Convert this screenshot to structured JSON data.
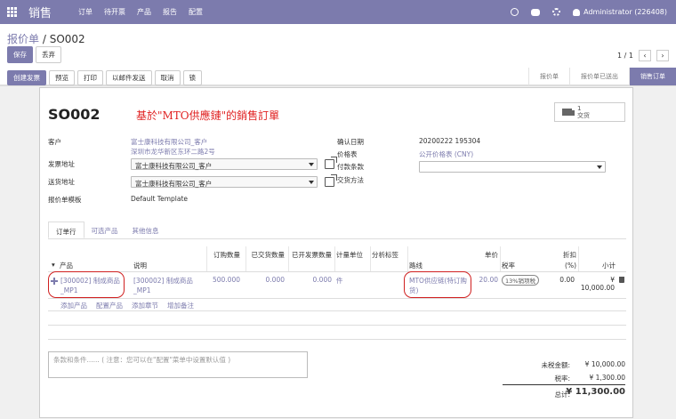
{
  "topbar": {
    "app_title": "销售",
    "menu": [
      "订单",
      "待开票",
      "产品",
      "报告",
      "配置"
    ],
    "user": "Administrator (226408)",
    "icons": [
      "clock-icon",
      "chat-icon",
      "gear-icon",
      "user-icon"
    ]
  },
  "breadcrumb": {
    "parent": "报价单",
    "separator": "/",
    "current": "SO002"
  },
  "buttons": {
    "save": "保存",
    "discard": "丢弃"
  },
  "pager": {
    "value": "1 / 1"
  },
  "actions": [
    "创建发票",
    "预览",
    "打印",
    "以邮件发送",
    "取消",
    "锁"
  ],
  "stages": [
    "报价单",
    "报价单已送出",
    "销售订单"
  ],
  "form": {
    "name": "SO002",
    "annotation": "基於\"MTO供應鏈\"的銷售訂單",
    "smart_button": {
      "count": "1",
      "label": "交货"
    },
    "customer_label": "客户",
    "customer_value": "富士康科技有限公司_客户",
    "customer_address": "深圳市龙华新区东环二路2号",
    "invoice_address_label": "发票地址",
    "invoice_address_value": "富士康科技有限公司_客户",
    "delivery_address_label": "送货地址",
    "delivery_address_value": "富士康科技有限公司_客户",
    "template_label": "报价单模板",
    "template_value": "Default Template",
    "date_label": "确认日期",
    "date_value": "20200222 195304",
    "pricelist_label": "价格表",
    "pricelist_value": "公开价格表 (CNY)",
    "payment_terms_label": "付款条款",
    "payment_terms_value": "",
    "delivery_method_label": "交货方法"
  },
  "tabs": [
    "订单行",
    "可选产品",
    "其他信息"
  ],
  "lines": {
    "headers": {
      "product": "产品",
      "description": "说明",
      "ordered_qty": "订购数量",
      "delivered_qty": "已交货数量",
      "invoiced_qty": "已开发票数量",
      "uom": "计量单位",
      "analytic_tags": "分析标签",
      "route": "路线",
      "unit_price": "单价",
      "taxes": "税率",
      "discount": "折扣\n(%)",
      "subtotal": "小计"
    },
    "rows": [
      {
        "product": "[300002] 制成商品_MP1",
        "description": "[300002] 制成商品_MP1",
        "ordered_qty": "500.000",
        "delivered_qty": "0.000",
        "invoiced_qty": "0.000",
        "uom": "件",
        "route": "MTO供应链(特订购货)",
        "unit_price": "20.00",
        "tax": "13%销项税",
        "discount": "0.00",
        "subtotal": "¥ 10,000.00"
      }
    ],
    "add_links": [
      "添加产品",
      "配置产品",
      "添加章节",
      "增加备注"
    ]
  },
  "note_placeholder": "条款和条件...... ( 注意：您可以在\"配置\"菜单中设置默认值 )",
  "totals": {
    "untaxed_label": "未税金额:",
    "untaxed_value": "¥ 10,000.00",
    "tax_label": "税率:",
    "tax_value": "¥ 1,300.00",
    "total_label": "总计:",
    "total_value": "¥ 11,300.00"
  },
  "colors": {
    "brand": "#7c7bad",
    "annotation": "#e02020"
  }
}
